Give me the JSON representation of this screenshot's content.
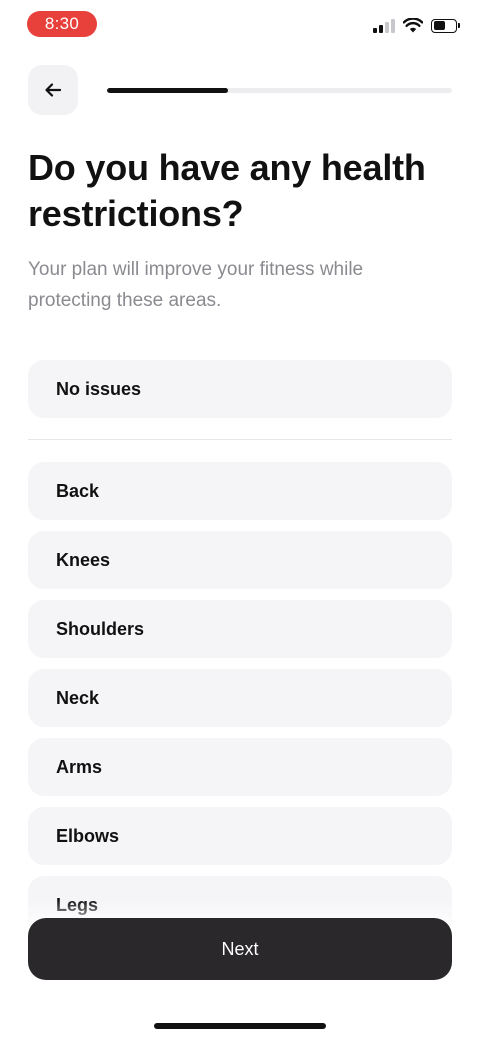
{
  "status_bar": {
    "time": "8:30",
    "time_pill_color": "#e8403a",
    "icons": [
      "cellular-signal-icon",
      "wifi-icon",
      "battery-icon"
    ],
    "battery_level": 0.55
  },
  "header": {
    "back_icon": "arrow-left-icon",
    "progress": 0.35
  },
  "title": "Do you have any health restrictions?",
  "subtitle": "Your plan will improve your fitness while protecting these areas.",
  "options": {
    "no_issues": "No issues",
    "areas": [
      "Back",
      "Knees",
      "Shoulders",
      "Neck",
      "Arms",
      "Elbows",
      "Legs"
    ]
  },
  "footer": {
    "next_label": "Next"
  }
}
